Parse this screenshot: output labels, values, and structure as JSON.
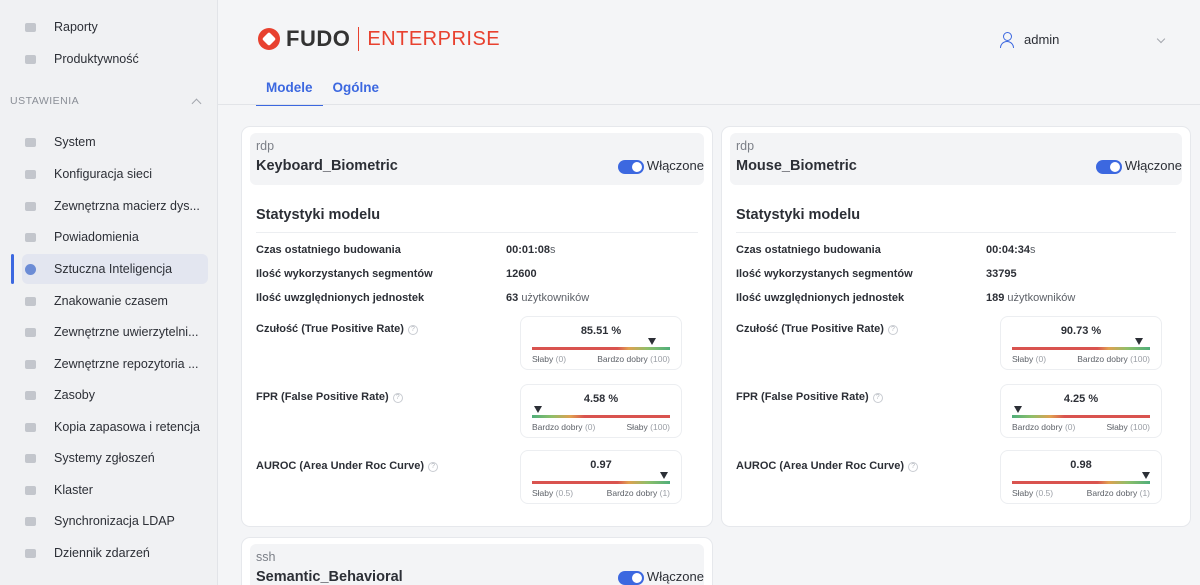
{
  "sidebar": {
    "top_items": [
      {
        "label": "Raporty",
        "icon": "printer-icon"
      },
      {
        "label": "Produktywność",
        "icon": "chart-line-icon"
      }
    ],
    "section_title": "USTAWIENIA",
    "items": [
      {
        "label": "System",
        "icon": "folder-icon"
      },
      {
        "label": "Konfiguracja sieci",
        "icon": "network-icon"
      },
      {
        "label": "Zewnętrzna macierz dys...",
        "icon": "storage-icon"
      },
      {
        "label": "Powiadomienia",
        "icon": "megaphone-icon"
      },
      {
        "label": "Sztuczna Inteligencja",
        "icon": "ai-icon",
        "active": true
      },
      {
        "label": "Znakowanie czasem",
        "icon": "stamp-icon"
      },
      {
        "label": "Zewnętrzne uwierzytelni...",
        "icon": "key-icon"
      },
      {
        "label": "Zewnętrzne repozytoria ...",
        "icon": "repository-icon"
      },
      {
        "label": "Zasoby",
        "icon": "resources-icon"
      },
      {
        "label": "Kopia zapasowa i retencja",
        "icon": "backup-icon"
      },
      {
        "label": "Systemy zgłoszeń",
        "icon": "tickets-icon"
      },
      {
        "label": "Klaster",
        "icon": "cluster-icon"
      },
      {
        "label": "Synchronizacja LDAP",
        "icon": "sync-icon"
      },
      {
        "label": "Dziennik zdarzeń",
        "icon": "calendar-icon"
      }
    ]
  },
  "header": {
    "logo_brand": "FUDO",
    "logo_edition": "ENTERPRISE",
    "user_name": "admin"
  },
  "tabs": [
    {
      "label": "Modele",
      "active": true
    },
    {
      "label": "Ogólne",
      "active": false
    }
  ],
  "labels": {
    "stats_title": "Statystyki modelu",
    "build_time": "Czas ostatniego budowania",
    "segments": "Ilość wykorzystanych segmentów",
    "units": "Ilość uwzględnionych jednostek",
    "tpr": "Czułość (True Positive Rate)",
    "fpr": "FPR (False Positive Rate)",
    "auroc": "AUROC (Area Under Roc Curve)",
    "users_suffix": "użytkowników",
    "toggle_on": "Włączone",
    "weak": "Słaby",
    "very_good": "Bardzo dobry",
    "tpr_weak_range": "(0)",
    "tpr_good_range": "(100)",
    "auroc_weak_range": "(0.5)",
    "auroc_good_range": "(1)"
  },
  "models": [
    {
      "protocol": "rdp",
      "name": "Keyboard_Biometric",
      "enabled": true,
      "build_time": "00:01:08",
      "build_unit": "s",
      "segments": "12600",
      "units": "63",
      "tpr": "85.51 %",
      "tpr_value": 0.8551,
      "fpr": "4.58 %",
      "fpr_value": 0.0458,
      "auroc": "0.97",
      "auroc_value": 0.97
    },
    {
      "protocol": "rdp",
      "name": "Mouse_Biometric",
      "enabled": true,
      "build_time": "00:04:34",
      "build_unit": "s",
      "segments": "33795",
      "units": "189",
      "tpr": "90.73 %",
      "tpr_value": 0.9073,
      "fpr": "4.25 %",
      "fpr_value": 0.0425,
      "auroc": "0.98",
      "auroc_value": 0.98
    },
    {
      "protocol": "ssh",
      "name": "Semantic_Behavioral",
      "enabled": true
    }
  ],
  "colors": {
    "accent": "#3c68e0",
    "brand": "#e8412f",
    "good": "#4fae7b",
    "bad": "#d9534f"
  }
}
